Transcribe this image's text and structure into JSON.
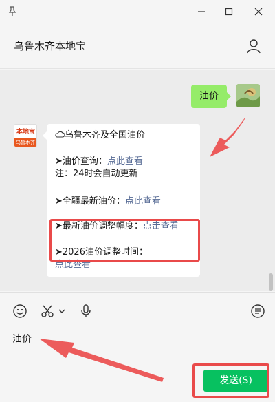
{
  "chat": {
    "title": "乌鲁木齐本地宝"
  },
  "messages": {
    "sent": {
      "text": "油价"
    },
    "received": {
      "sender_logo_top": "本地宝",
      "sender_logo_bottom": "乌鲁木齐",
      "heading": "乌鲁木齐及全国油价",
      "line1_label": "➤油价查询：",
      "line1_link": "点此查看",
      "line1_note": "注：24时会自动更新",
      "line2_label": "➤全疆最新油价：",
      "line2_link": "点此查看",
      "line3_label": "➤最新油价调整幅度：",
      "line3_link": "点击查看",
      "line4_label": "➤2026油价调整时间：",
      "line4_link": "点此查看"
    }
  },
  "input": {
    "value": "油价"
  },
  "send_button": {
    "label": "发送(S)"
  },
  "colors": {
    "accent": "#07c160",
    "sent_bubble": "#95ec69",
    "link": "#576b95",
    "highlight": "#e94a4a"
  },
  "icons": [
    "pin-icon",
    "minimize-icon",
    "maximize-icon",
    "close-icon",
    "profile-icon",
    "cloud-icon",
    "emoji-icon",
    "scissors-icon",
    "chevron-down-icon",
    "microphone-icon",
    "chat-history-icon"
  ]
}
